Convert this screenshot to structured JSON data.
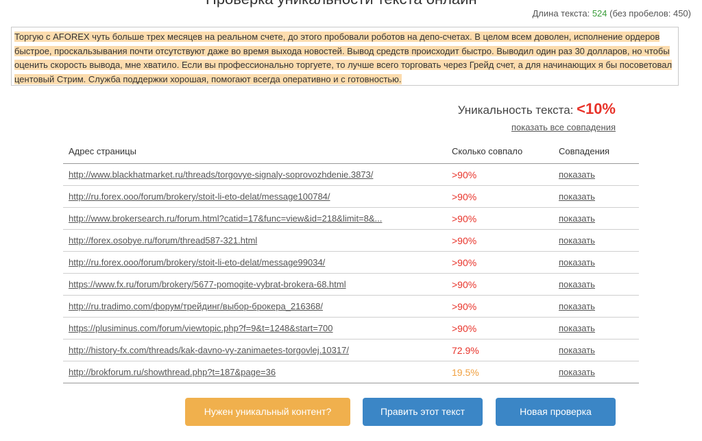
{
  "header": {
    "title_cut": "Проверка уникальности текста онлайн",
    "length_label": "Длина текста:",
    "length_value": "524",
    "no_spaces": "(без пробелов: 450)"
  },
  "text_box": {
    "content": "Торгую с AFOREX чуть больше трех месяцев на реальном счете, до этого пробовали роботов на депо-счетах. В целом всем доволен, исполнение ордеров быстрое, проскальзывания почти отсутствуют даже во время выхода новостей. Вывод средств происходит быстро. Выводил один раз 30 долларов, но чтобы оценить скорость вывода, мне хватило. Если вы профессионально торгуете, то лучше всего торговать через Грейд счет, а для начинающих я бы посоветовал центовый Стрим. Служба поддержки хорошая, помогают всегда оперативно и с готовностью."
  },
  "uniqueness": {
    "label": "Уникальность текста:",
    "value": "<10%",
    "show_all": "показать все совпадения"
  },
  "table": {
    "headers": [
      "Адрес страницы",
      "Сколько совпало",
      "Совпадения"
    ],
    "rows": [
      {
        "url": "http://www.blackhatmarket.ru/threads/torgovye-signaly-soprovozhdenie.3873/",
        "pct": ">90%",
        "color": "#e8332a",
        "show": "показать"
      },
      {
        "url": "http://ru.forex.ooo/forum/brokery/stoit-li-eto-delat/message100784/",
        "pct": ">90%",
        "color": "#e8332a",
        "show": "показать"
      },
      {
        "url": "http://www.brokersearch.ru/forum.html?catid=17&func=view&id=218&limit=8&...",
        "pct": ">90%",
        "color": "#e8332a",
        "show": "показать"
      },
      {
        "url": "http://forex.osobye.ru/forum/thread587-321.html",
        "pct": ">90%",
        "color": "#e8332a",
        "show": "показать"
      },
      {
        "url": "http://ru.forex.ooo/forum/brokery/stoit-li-eto-delat/message99034/",
        "pct": ">90%",
        "color": "#e8332a",
        "show": "показать"
      },
      {
        "url": "https://www.fx.ru/forum/brokery/5677-pomogite-vybrat-brokera-68.html",
        "pct": ">90%",
        "color": "#e8332a",
        "show": "показать"
      },
      {
        "url": "http://ru.tradimo.com/форум/трейдинг/выбор-брокера_216368/",
        "pct": ">90%",
        "color": "#e8332a",
        "show": "показать"
      },
      {
        "url": "https://plusiminus.com/forum/viewtopic.php?f=9&t=1248&start=700",
        "pct": ">90%",
        "color": "#e8332a",
        "show": "показать"
      },
      {
        "url": "http://history-fx.com/threads/kak-davno-vy-zanimaetes-torgovlej.10317/",
        "pct": "72.9%",
        "color": "#e8332a",
        "show": "показать"
      },
      {
        "url": "http://brokforum.ru/showthread.php?t=187&page=36",
        "pct": "19.5%",
        "color": "#f0a040",
        "show": "показать"
      }
    ]
  },
  "buttons": {
    "need_content": "Нужен уникальный контент?",
    "edit_text": "Править этот текст",
    "new_check": "Новая проверка"
  },
  "colors": {
    "accent_red": "#e8332a",
    "accent_orange": "#f0b04d",
    "accent_blue": "#3b86c6",
    "highlight": "#fcdcae"
  }
}
